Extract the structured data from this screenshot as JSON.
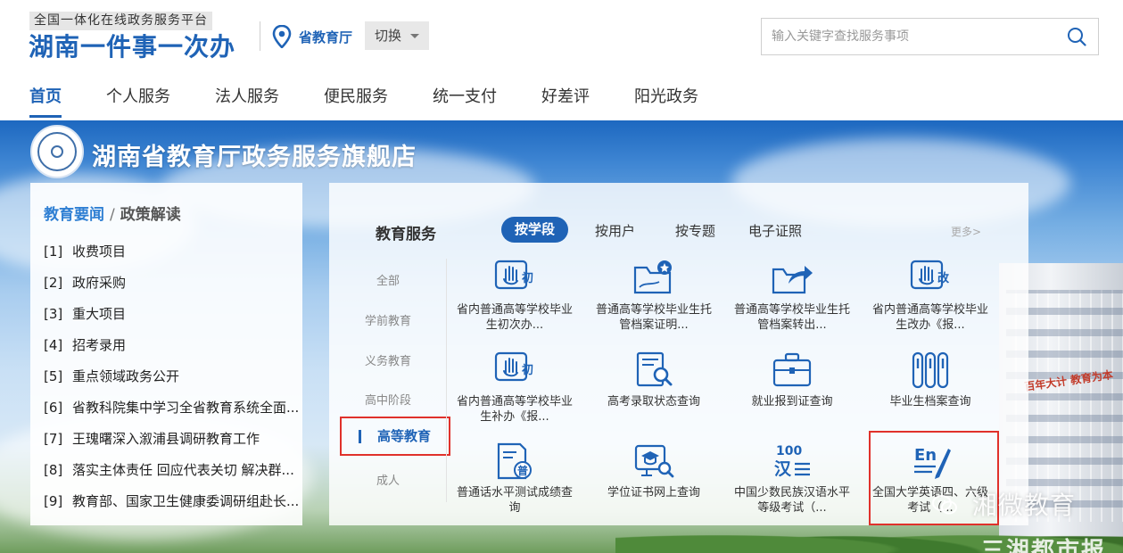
{
  "header": {
    "platform_tag": "全国一体化在线政务服务平台",
    "site_title": "湖南一件事一次办",
    "location_name": "省教育厅",
    "switch_label": "切换",
    "search_placeholder": "输入关键字查找服务事项"
  },
  "nav": {
    "items": [
      {
        "label": "首页"
      },
      {
        "label": "个人服务"
      },
      {
        "label": "法人服务"
      },
      {
        "label": "便民服务"
      },
      {
        "label": "统一支付"
      },
      {
        "label": "好差评"
      },
      {
        "label": "阳光政务"
      }
    ]
  },
  "banner": {
    "store_title": "湖南省教育厅政务服务旗舰店",
    "building_sign": "百年大计 教育为本"
  },
  "news": {
    "tab_active": "教育要闻",
    "tab_sep": "/",
    "tab_other": "政策解读",
    "items": [
      {
        "num": "[1]",
        "text": "收费项目"
      },
      {
        "num": "[2]",
        "text": "政府采购"
      },
      {
        "num": "[3]",
        "text": "重大项目"
      },
      {
        "num": "[4]",
        "text": "招考录用"
      },
      {
        "num": "[5]",
        "text": "重点领域政务公开"
      },
      {
        "num": "[6]",
        "text": "省教科院集中学习全省教育系统全面..."
      },
      {
        "num": "[7]",
        "text": "王瑰曙深入溆浦县调研教育工作"
      },
      {
        "num": "[8]",
        "text": "落实主体责任 回应代表关切 解决群..."
      },
      {
        "num": "[9]",
        "text": "教育部、国家卫生健康委调研组赴长..."
      }
    ]
  },
  "services": {
    "title": "教育服务",
    "tabs": [
      {
        "label": "按学段"
      },
      {
        "label": "按用户"
      },
      {
        "label": "按专题"
      },
      {
        "label": "电子证照"
      }
    ],
    "more": "更多>",
    "categories": [
      {
        "label": "全部"
      },
      {
        "label": "学前教育"
      },
      {
        "label": "义务教育"
      },
      {
        "label": "高中阶段"
      },
      {
        "label": "高等教育"
      },
      {
        "label": "成人"
      }
    ],
    "items": [
      {
        "icon": "hand-first-icon",
        "badge": "初",
        "label": "省内普通高等学校毕业生初次办..."
      },
      {
        "icon": "folder-star-icon",
        "badge": "",
        "label": "普通高等学校毕业生托管档案证明..."
      },
      {
        "icon": "folder-transfer-icon",
        "badge": "",
        "label": "普通高等学校毕业生托管档案转出..."
      },
      {
        "icon": "hand-change-icon",
        "badge": "改",
        "label": "省内普通高等学校毕业生改办《报..."
      },
      {
        "icon": "hand-first-icon",
        "badge": "初",
        "label": "省内普通高等学校毕业生补办《报..."
      },
      {
        "icon": "document-search-icon",
        "badge": "",
        "label": "高考录取状态查询"
      },
      {
        "icon": "briefcase-icon",
        "badge": "",
        "label": "就业报到证查询"
      },
      {
        "icon": "archive-files-icon",
        "badge": "",
        "label": "毕业生档案查询"
      },
      {
        "icon": "mandarin-test-icon",
        "badge": "普",
        "label": "普通话水平测试成绩查询"
      },
      {
        "icon": "degree-search-icon",
        "badge": "",
        "label": "学位证书网上查询"
      },
      {
        "icon": "hanyu-level-icon",
        "badge": "100 汉",
        "label": "中国少数民族汉语水平等级考试（..."
      },
      {
        "icon": "english-test-icon",
        "badge": "En",
        "label": "全国大学英语四、六级考试（..."
      }
    ]
  },
  "watermark": {
    "text": "湘微教育",
    "corner": "三湘都市报"
  },
  "colors": {
    "brand_blue": "#1f63b6",
    "highlight_red": "#e0312b"
  }
}
